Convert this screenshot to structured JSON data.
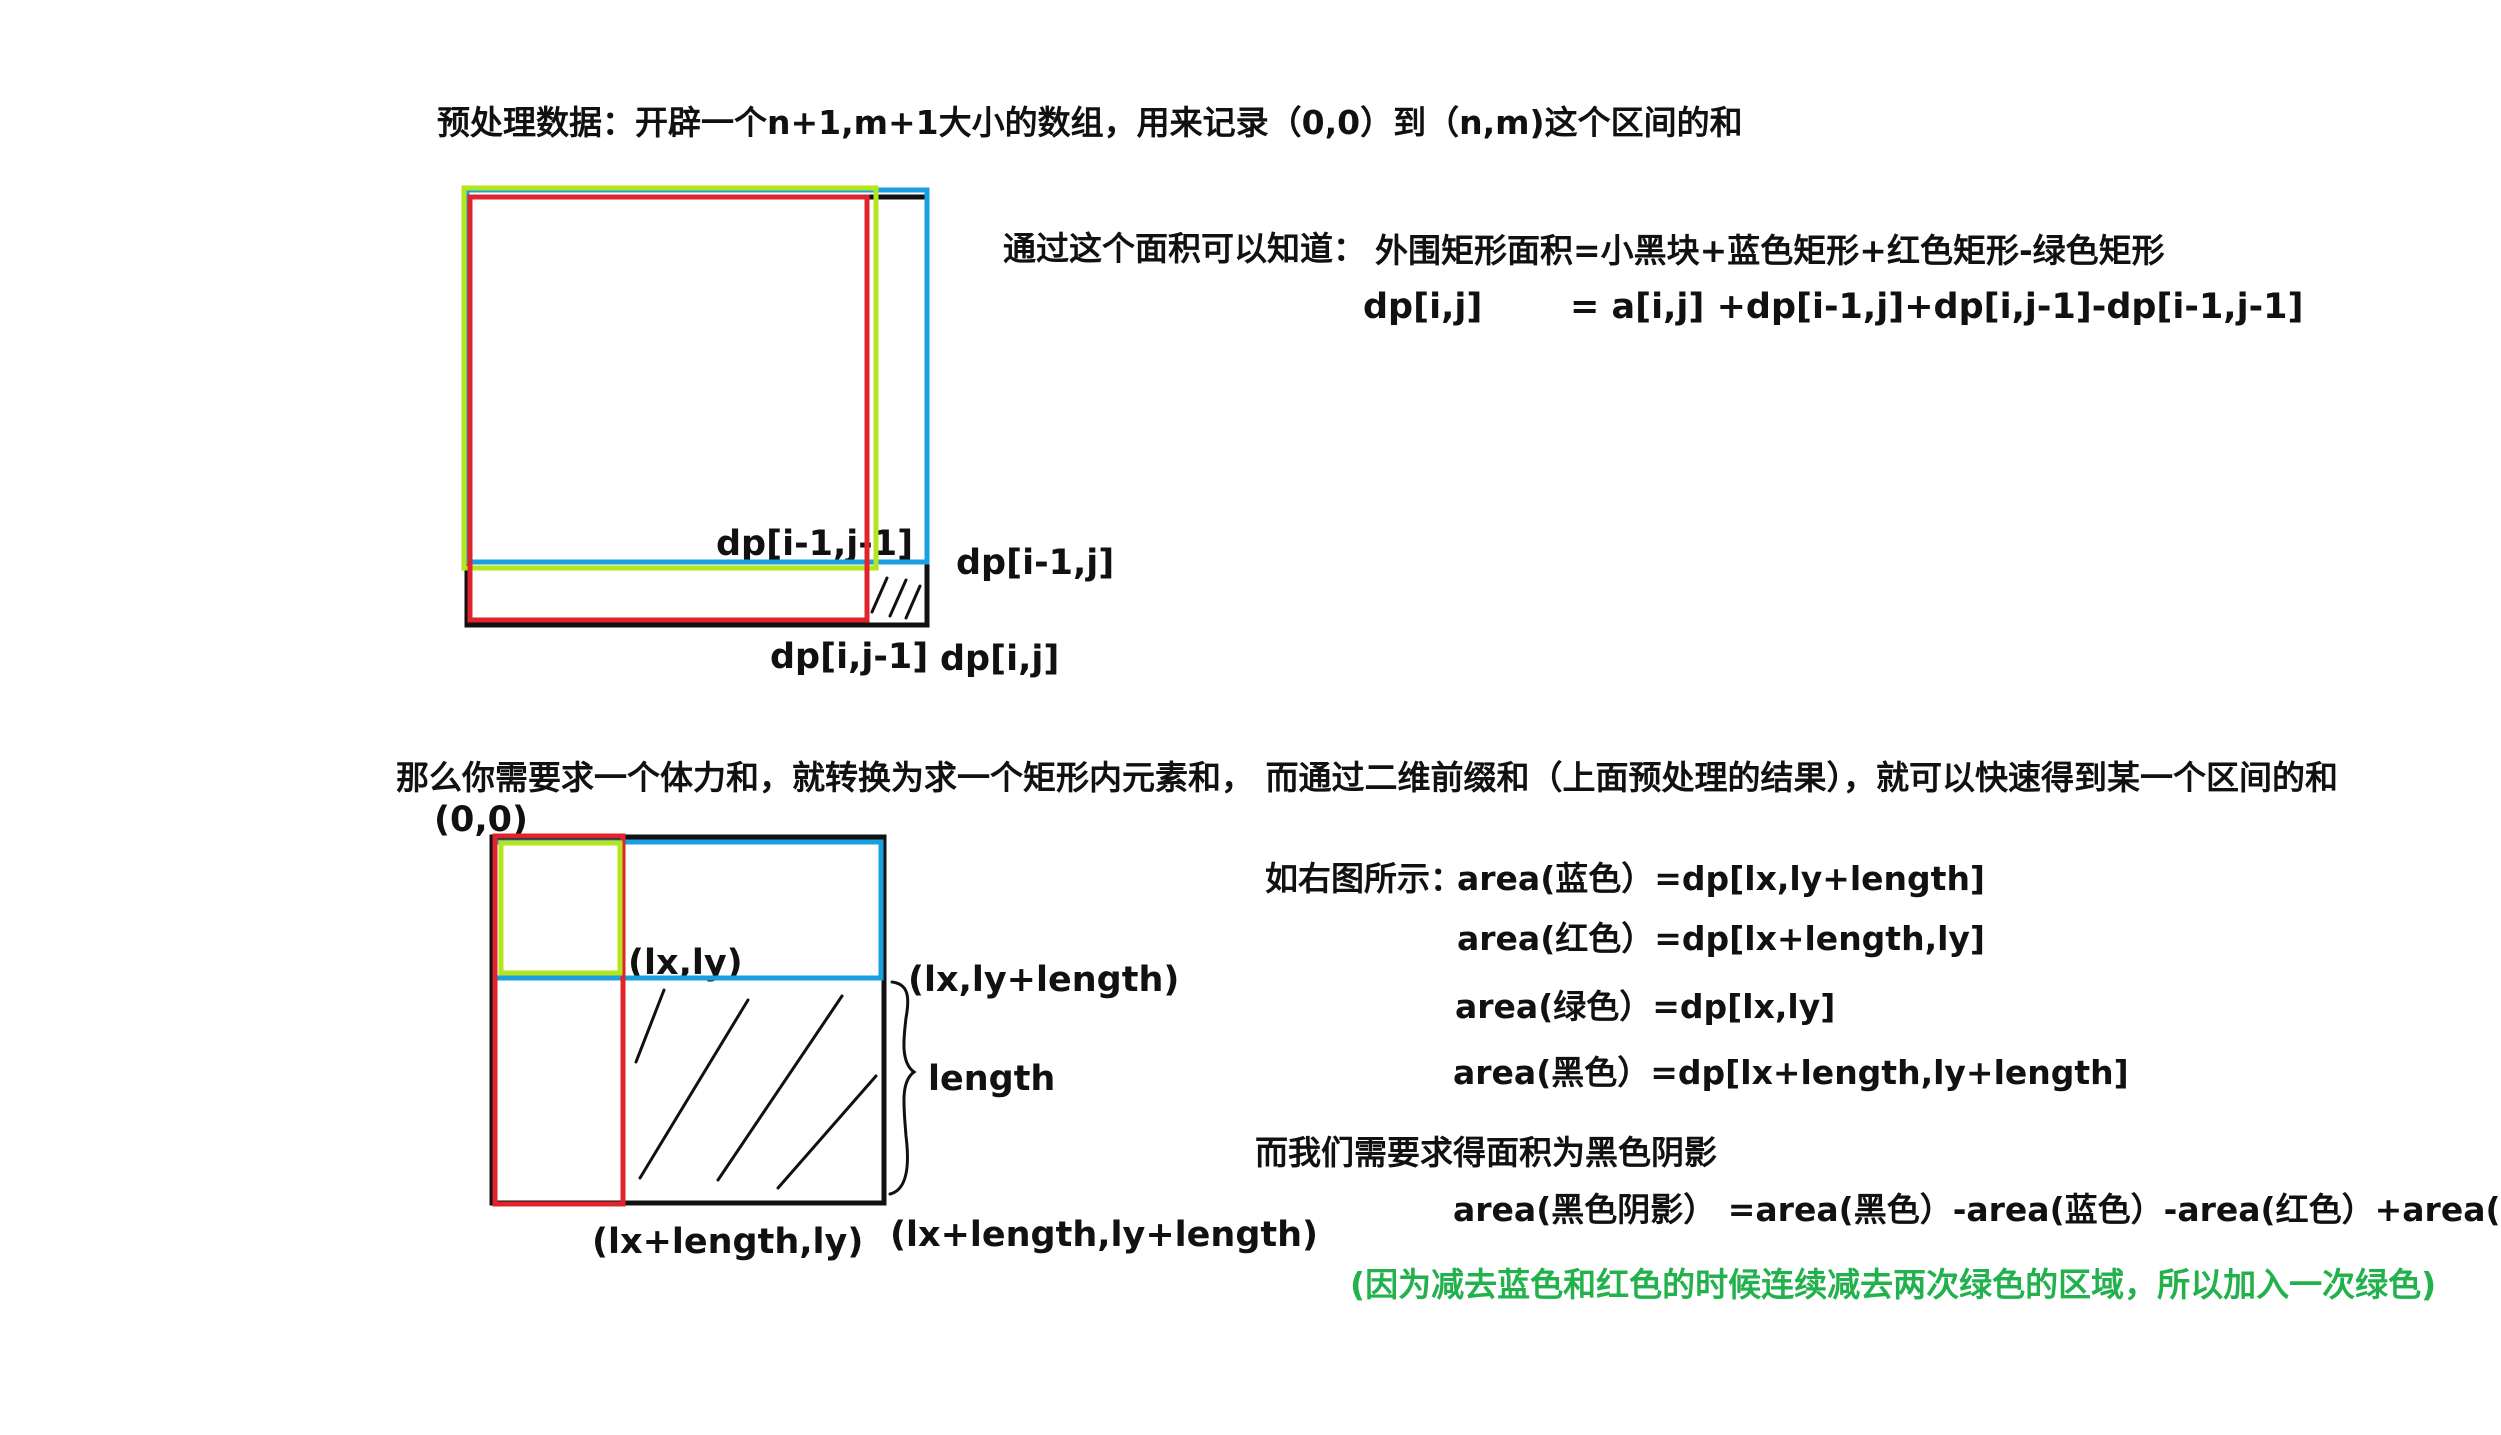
{
  "header": {
    "preprocess": "预处理数据：开辟一个n+1,m+1大小的数组，用来记录（0,0）到（n,m)这个区间的和"
  },
  "formula1": {
    "intro": "通过这个面积可以知道：",
    "words": "外围矩形面积=小黑块+蓝色矩形+红色矩形-绿色矩形",
    "lhs": "dp[i,j]",
    "rhs": "= a[i,j]   +dp[i-1,j]+dp[i,j-1]-dp[i-1,j-1]"
  },
  "diagram1": {
    "label_green": "dp[i-1,j-1]",
    "label_blue": "dp[i-1,j]",
    "label_red": "dp[i,j-1]",
    "label_black": "dp[i,j]"
  },
  "section2": {
    "intro": "那么你需要求一个体力和，就转换为求一个矩形内元素和， 而通过二维前缀和（上面预处理的结果），就可以快速得到某一个区间的和"
  },
  "diagram2": {
    "origin": "(0,0)",
    "p_lxly": "(lx,ly)",
    "p_lxly_len": "(lx,ly+length)",
    "length": "length",
    "p_lxlen_ly": "(lx+length,ly)",
    "p_lxlen_lylen": "(lx+length,ly+length)"
  },
  "areas": {
    "intro": "如右图所示：",
    "blue": "area(蓝色）=dp[lx,ly+length]",
    "red": "area(红色）=dp[lx+length,ly]",
    "green": "area(绿色）=dp[lx,ly]",
    "black": "area(黑色）=dp[lx+length,ly+length]",
    "need": "而我们需要求得面积为黑色阴影",
    "result": "area(黑色阴影） =area(黑色）-area(蓝色）-area(红色）+area(绿色)",
    "note": "(因为减去蓝色和红色的时候连续减去两次绿色的区域，所以加入一次绿色)"
  },
  "colors": {
    "red": "#e0242b",
    "blue": "#1aa0e0",
    "green": "#b5e61d",
    "black": "#111111",
    "note_green": "#22b14c"
  }
}
